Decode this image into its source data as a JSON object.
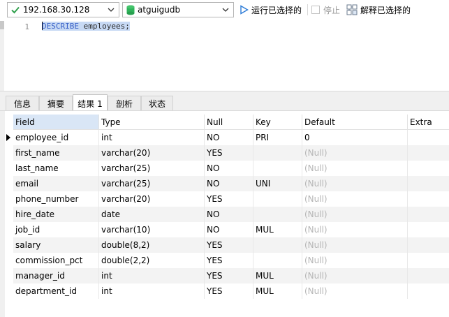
{
  "toolbar": {
    "connection": "192.168.30.128",
    "database": "atguigudb",
    "run_selected_label": "运行已选择的",
    "stop_label": "停止",
    "explain_selected_label": "解释已选择的"
  },
  "editor": {
    "line_number": "1",
    "keyword": "DESCRIBE",
    "table_name": "employees;"
  },
  "tabs": [
    {
      "label": "信息"
    },
    {
      "label": "摘要"
    },
    {
      "label": "结果 1"
    },
    {
      "label": "剖析"
    },
    {
      "label": "状态"
    }
  ],
  "active_tab": "结果 1",
  "result": {
    "columns": [
      "Field",
      "Type",
      "Null",
      "Key",
      "Default",
      "Extra"
    ],
    "rows": [
      [
        "employee_id",
        "int",
        "NO",
        "PRI",
        "0",
        ""
      ],
      [
        "first_name",
        "varchar(20)",
        "YES",
        "",
        "(Null)",
        ""
      ],
      [
        "last_name",
        "varchar(25)",
        "NO",
        "",
        "(Null)",
        ""
      ],
      [
        "email",
        "varchar(25)",
        "NO",
        "UNI",
        "(Null)",
        ""
      ],
      [
        "phone_number",
        "varchar(20)",
        "YES",
        "",
        "(Null)",
        ""
      ],
      [
        "hire_date",
        "date",
        "NO",
        "",
        "(Null)",
        ""
      ],
      [
        "job_id",
        "varchar(10)",
        "NO",
        "MUL",
        "(Null)",
        ""
      ],
      [
        "salary",
        "double(8,2)",
        "YES",
        "",
        "(Null)",
        ""
      ],
      [
        "commission_pct",
        "double(2,2)",
        "YES",
        "",
        "(Null)",
        ""
      ],
      [
        "manager_id",
        "int",
        "YES",
        "MUL",
        "(Null)",
        ""
      ],
      [
        "department_id",
        "int",
        "YES",
        "MUL",
        "(Null)",
        ""
      ]
    ]
  },
  "colors": {
    "header_selected": "#d9e6f6",
    "selection": "#c7d9f4",
    "keyword": "#3a62c8",
    "db_icon": "#2fb35a",
    "run_icon": "#2a7ad6",
    "null_text": "#b5b5b5"
  },
  "icons": {
    "connection": "connection-check-icon",
    "database": "database-icon",
    "run": "play-icon",
    "stop": "stop-checkbox-icon",
    "explain": "explain-icon",
    "dropdown": "chevron-down-icon",
    "row_pointer": "row-pointer-icon"
  }
}
